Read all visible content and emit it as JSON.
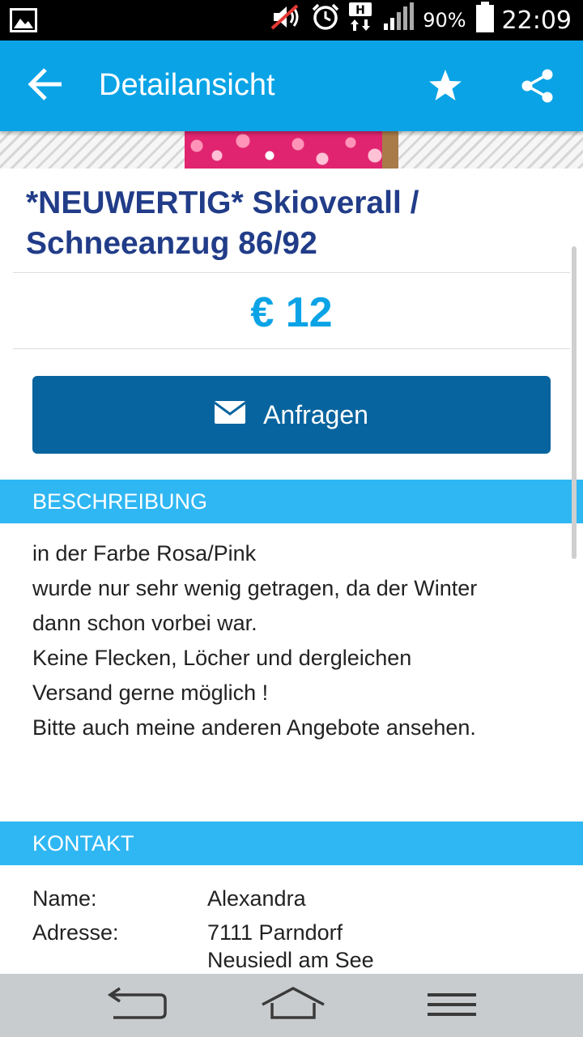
{
  "status_bar": {
    "battery_percent": "90%",
    "time": "22:09",
    "network_label": "H"
  },
  "app_bar": {
    "title": "Detailansicht"
  },
  "listing": {
    "title": "*NEUWERTIG* Skioverall / Schneeanzug 86/92",
    "price": "€ 12",
    "ask_button_label": "Anfragen"
  },
  "description": {
    "header": "BESCHREIBUNG",
    "lines": [
      "in der Farbe Rosa/Pink",
      "wurde nur sehr wenig getragen, da der Winter",
      "dann schon vorbei war.",
      "Keine Flecken, Löcher und dergleichen",
      "",
      "Versand gerne möglich !",
      "Bitte auch meine anderen Angebote ansehen."
    ]
  },
  "contact": {
    "header": "KONTAKT",
    "name_label": "Name:",
    "name_value": "Alexandra",
    "address_label": "Adresse:",
    "address_line1": "7111 Parndorf",
    "address_line2": "Neusiedl am See"
  },
  "colors": {
    "app_bar": "#0aa3e6",
    "title_text": "#213c88",
    "price_text": "#0aa3e6",
    "button": "#08649e",
    "section_header": "#2fb7f3"
  },
  "icons": {
    "status": [
      "image-icon",
      "muted-volume-icon",
      "alarm-icon",
      "network-h-icon",
      "signal-icon",
      "battery-icon"
    ],
    "app_bar": [
      "back-arrow-icon",
      "star-icon",
      "share-icon"
    ],
    "button": "mail-icon",
    "navigation": [
      "back-nav-icon",
      "home-nav-icon",
      "menu-nav-icon"
    ]
  }
}
